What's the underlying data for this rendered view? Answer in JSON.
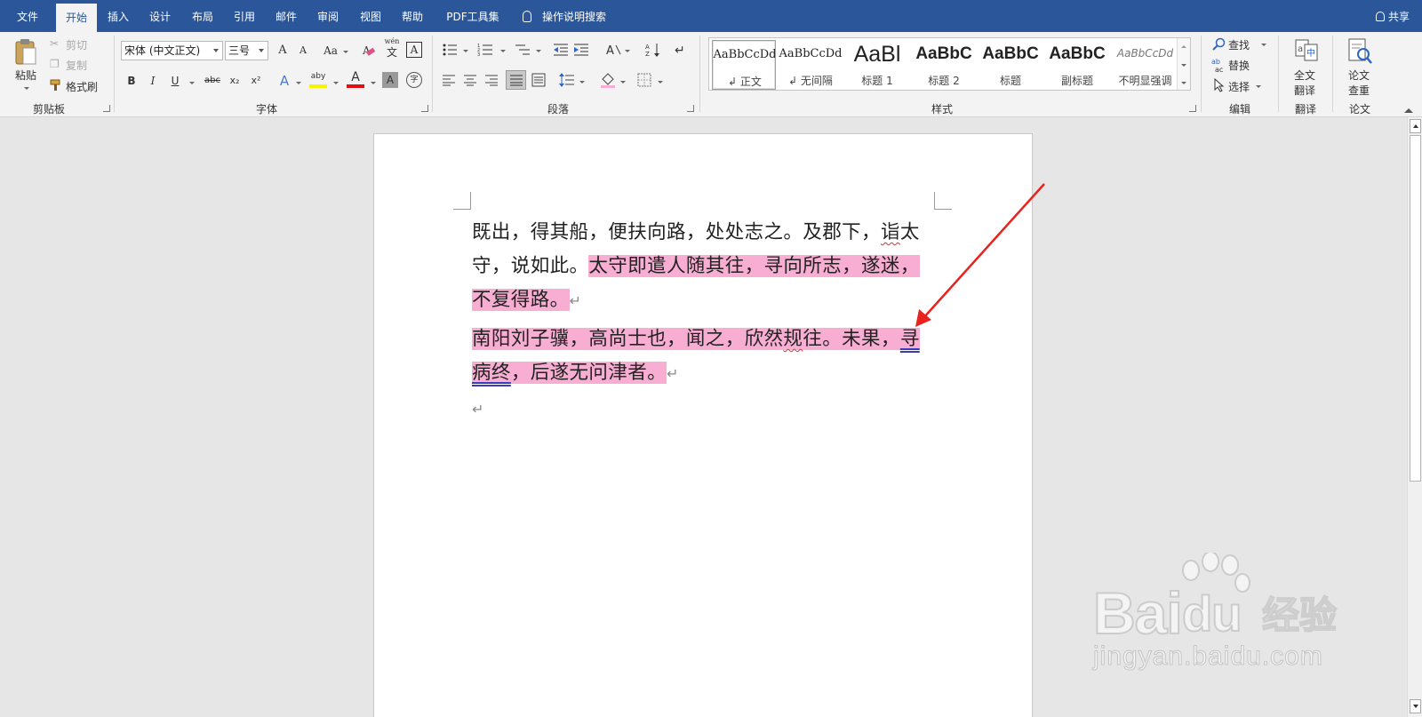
{
  "menubar": {
    "tabs": [
      "文件",
      "开始",
      "插入",
      "设计",
      "布局",
      "引用",
      "邮件",
      "审阅",
      "视图",
      "帮助",
      "PDF工具集"
    ],
    "active_tab": "开始",
    "tell_me": "操作说明搜索",
    "share": "共享",
    "bar_color": "#2b579a"
  },
  "ribbon": {
    "clipboard": {
      "paste": "粘贴",
      "cut": "剪切",
      "copy": "复制",
      "format_painter": "格式刷",
      "label": "剪贴板"
    },
    "font": {
      "font_name": "宋体 (中文正文)",
      "font_size": "三号",
      "label": "字体",
      "grow": "A",
      "shrink": "A",
      "case": "Aa",
      "bold": "B",
      "italic": "I",
      "underline": "U",
      "strike": "abc",
      "sub": "x₂",
      "sup": "x²",
      "phonetic_top": "wén",
      "phonetic_char": "文",
      "char_border": "A",
      "effects": "A",
      "highlight": "aby",
      "font_color": "A",
      "char_shading": "A",
      "enclose": "字"
    },
    "paragraph": {
      "label": "段落"
    },
    "styles": {
      "label": "样式",
      "items": [
        {
          "sample": "AaBbCcDd",
          "name": "正文",
          "selected": true
        },
        {
          "sample": "AaBbCcDd",
          "name": "无间隔",
          "selected": false
        },
        {
          "sample": "AaBl",
          "name": "标题 1",
          "selected": false
        },
        {
          "sample": "AaBbC",
          "name": "标题 2",
          "selected": false
        },
        {
          "sample": "AaBbC",
          "name": "标题",
          "selected": false
        },
        {
          "sample": "AaBbC",
          "name": "副标题",
          "selected": false
        },
        {
          "sample": "AaBbCcDd",
          "name": "不明显强调",
          "selected": false
        }
      ]
    },
    "editing": {
      "label": "编辑",
      "find": "查找",
      "replace": "替换",
      "select": "选择"
    },
    "translate": {
      "label": "翻译",
      "full_translate_line1": "全文",
      "full_translate_line2": "翻译"
    },
    "paper": {
      "label": "论文",
      "check_line1": "论文",
      "check_line2": "查重"
    }
  },
  "document": {
    "paragraphs": [
      {
        "lines": [
          {
            "plain": "既出，得其船，便扶向路，处处志之。及郡下，",
            "wavy": "诣",
            "plain2": "太"
          },
          {
            "plain": "守，说如此。",
            "highlight": "太守即遣人随其往，寻向所志，遂迷，"
          },
          {
            "highlight": "不复得路。",
            "mark": "↵"
          }
        ]
      },
      {
        "lines": [
          {
            "highlight": "南阳刘子骥，高尚士也，闻之，欣然",
            "wavy": "规",
            "highlight2": "往。未果，",
            "dbl": "寻"
          },
          {
            "dbl": "病终",
            "highlight": "，后遂无问津者。",
            "mark": "↵"
          }
        ]
      },
      {
        "lines": [
          {
            "mark": "↵"
          }
        ]
      }
    ],
    "highlight_color": "#f7aed2",
    "annotation_arrow_color": "#e8231e"
  },
  "watermark": {
    "logo_text": "Bai",
    "logo_text2": "du",
    "brand": "经验",
    "url": "jingyan.baidu.com"
  }
}
